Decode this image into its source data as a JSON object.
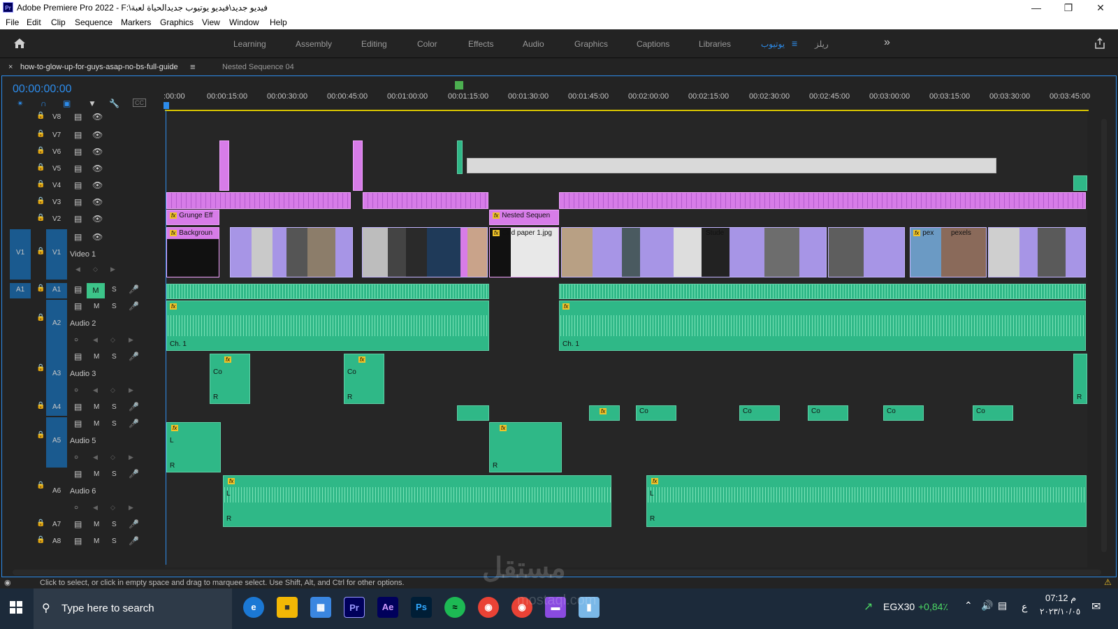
{
  "window": {
    "title": "Adobe Premiere Pro 2022 - F:\\فيديو جديد\\فيديو يوتيوب جديدالحياة لعبة",
    "app_icon": "Pr"
  },
  "menu": [
    "File",
    "Edit",
    "Clip",
    "Sequence",
    "Markers",
    "Graphics",
    "View",
    "Window",
    "Help"
  ],
  "workspace_tabs": [
    {
      "label": "Learning"
    },
    {
      "label": "Assembly"
    },
    {
      "label": "Editing"
    },
    {
      "label": "Color"
    },
    {
      "label": "Effects"
    },
    {
      "label": "Audio"
    },
    {
      "label": "Graphics"
    },
    {
      "label": "Captions"
    },
    {
      "label": "Libraries"
    },
    {
      "label": "يوتيوب",
      "active": true
    },
    {
      "label": "ريلز"
    }
  ],
  "sequence_tabs": [
    {
      "label": "how-to-glow-up-for-guys-asap-no-bs-full-guide",
      "active": true
    },
    {
      "label": "Nested Sequence 04"
    }
  ],
  "timecode": "00:00:00:00",
  "ruler_ticks": [
    ":00:00",
    "00:00:15:00",
    "00:00:30:00",
    "00:00:45:00",
    "00:01:00:00",
    "00:01:15:00",
    "00:01:30:00",
    "00:01:45:00",
    "00:02:00:00",
    "00:02:15:00",
    "00:02:30:00",
    "00:02:45:00",
    "00:03:00:00",
    "00:03:15:00",
    "00:03:30:00",
    "00:03:45:00"
  ],
  "video_tracks": [
    {
      "id": "V8"
    },
    {
      "id": "V7"
    },
    {
      "id": "V6"
    },
    {
      "id": "V5"
    },
    {
      "id": "V4"
    },
    {
      "id": "V3"
    },
    {
      "id": "V2"
    },
    {
      "id": "V1",
      "name": "Video 1",
      "source": "V1"
    }
  ],
  "audio_tracks": [
    {
      "id": "A1",
      "source": "A1",
      "mute": "M",
      "solo": "S"
    },
    {
      "id": "A2",
      "name": "Audio 2",
      "mute": "M",
      "solo": "S"
    },
    {
      "id": "A3",
      "name": "Audio 3",
      "mute": "M",
      "solo": "S"
    },
    {
      "id": "A4",
      "mute": "M",
      "solo": "S"
    },
    {
      "id": "A5",
      "name": "Audio 5",
      "mute": "M",
      "solo": "S"
    },
    {
      "id": "A6",
      "name": "Audio 6",
      "mute": "M",
      "solo": "S"
    },
    {
      "id": "A7",
      "mute": "M",
      "solo": "S"
    },
    {
      "id": "A8",
      "mute": "M",
      "solo": "S"
    }
  ],
  "clip_labels": {
    "grunge": "Grunge Eff",
    "background": "Backgroun",
    "nested": "Nested Sequen",
    "grid": "Grid paper 1.jpg",
    "stude": "Stude",
    "pex": "pex",
    "pexels": "pexels",
    "ch1": "Ch. 1",
    "fx": "fx",
    "L": "L",
    "R": "R",
    "Co": "Co"
  },
  "status_text": "Click to select, or click in empty space and drag to marquee select. Use Shift, Alt, and Ctrl for other options.",
  "taskbar": {
    "search_placeholder": "Type here to search",
    "ticker_name": "EGX30",
    "ticker_change": "+0,84٪",
    "time": "07:12 م",
    "date": "٢٠٢٣/١٠/٠٥",
    "lang": "ع"
  },
  "colors": {
    "accent": "#2d8ceb",
    "video_clip": "#d77ce8",
    "video_clip_lav": "#a795e6",
    "audio_clip": "#2fb887",
    "playhead_bar": "#d8c400"
  },
  "watermark": "مستقل mostaql.com"
}
